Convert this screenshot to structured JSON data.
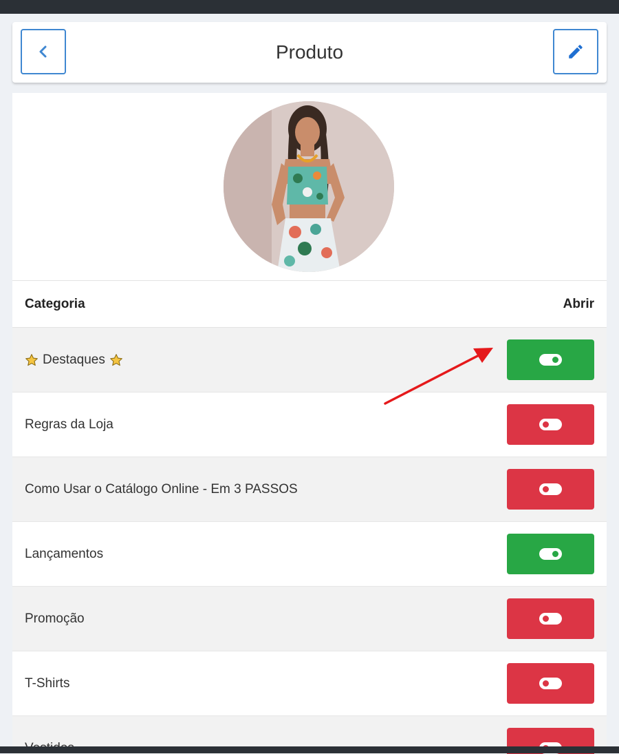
{
  "header": {
    "title": "Produto",
    "back_icon": "chevron-left-icon",
    "edit_icon": "pencil-icon"
  },
  "product": {
    "image_alt": "product-photo"
  },
  "table": {
    "col_category": "Categoria",
    "col_open": "Abrir",
    "rows": [
      {
        "label": "Destaques",
        "starred": true,
        "state": "on"
      },
      {
        "label": "Regras da Loja",
        "state": "off"
      },
      {
        "label": "Como Usar o Catálogo Online - Em 3 PASSOS",
        "state": "off"
      },
      {
        "label": "Lançamentos",
        "state": "on"
      },
      {
        "label": "Promoção",
        "state": "off"
      },
      {
        "label": "T-Shirts",
        "state": "off"
      },
      {
        "label": "Vestidos",
        "state": "off"
      }
    ]
  },
  "colors": {
    "accent_blue": "#3f87d1",
    "toggle_on": "#28a745",
    "toggle_off": "#dc3545",
    "annotation_arrow": "#e5191b"
  }
}
